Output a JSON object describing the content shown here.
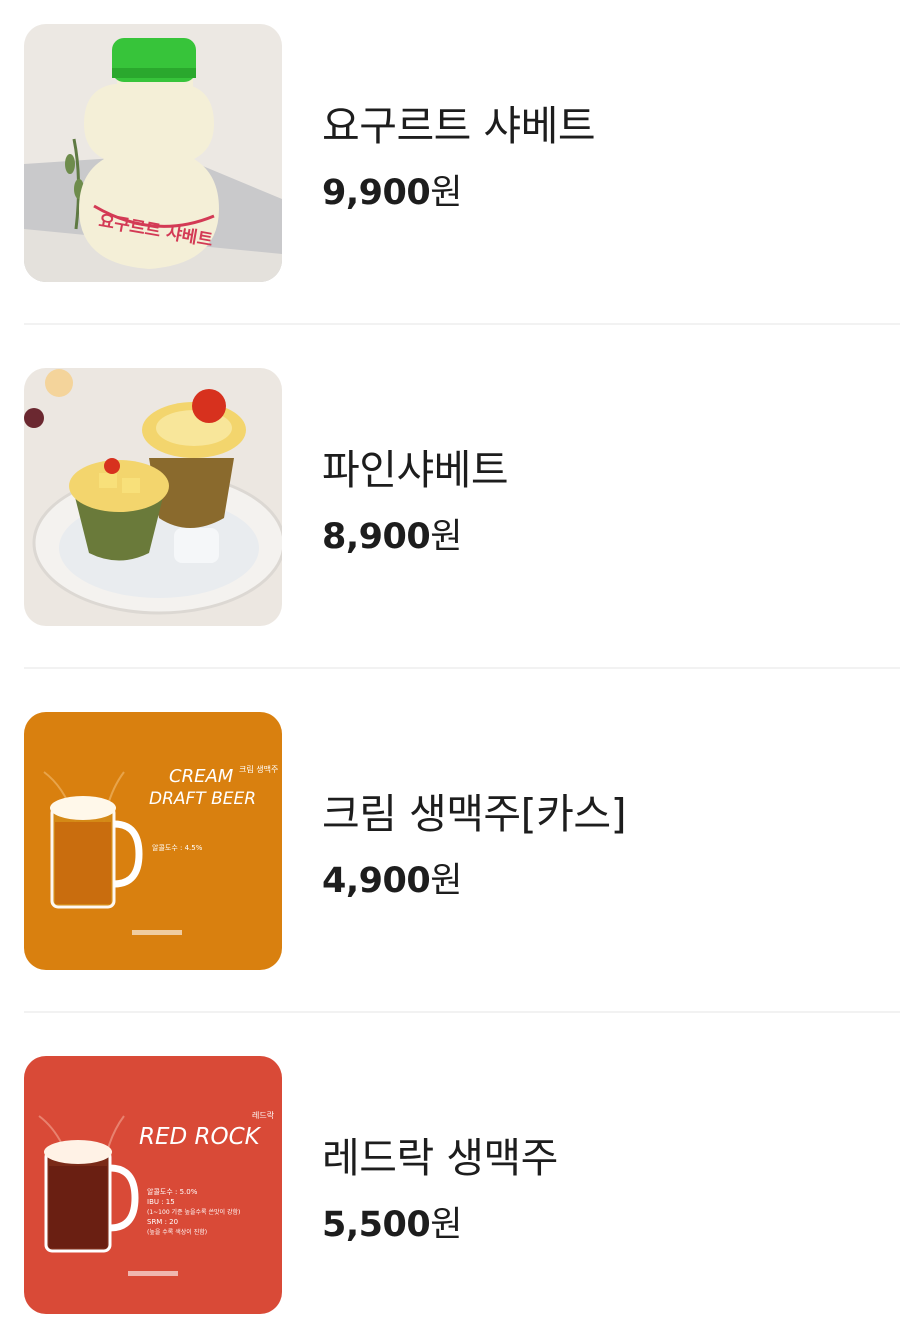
{
  "menu_items": [
    {
      "name": "요구르트 샤베트",
      "price": "9,900",
      "currency": "원",
      "image_icon": "yogurt-bottle-photo",
      "image_text": [
        "요구르트 샤베트"
      ]
    },
    {
      "name": "파인샤베트",
      "price": "8,900",
      "currency": "원",
      "image_icon": "pineapple-sherbet-photo"
    },
    {
      "name": "크림 생맥주[카스]",
      "price": "4,900",
      "currency": "원",
      "image_icon": "beer-mug-orange-poster",
      "image_text": [
        "CREAM",
        "DRAFT BEER",
        "크림 생맥주",
        "알콜도수 : 4.5%"
      ]
    },
    {
      "name": "레드락 생맥주",
      "price": "5,500",
      "currency": "원",
      "image_icon": "beer-mug-red-poster",
      "image_text": [
        "RED ROCK",
        "레드락",
        "알콜도수 : 5.0%",
        "IBU : 15",
        "(1~100 기준 높을수록 쓴맛이 강함)",
        "SRM : 20",
        "(높을 수록 색상이 진함)"
      ]
    }
  ],
  "colors": {
    "orange_poster": "#d9800f",
    "red_poster": "#d94a37",
    "divider": "#f2f2f2",
    "text": "#1d1d1d"
  }
}
